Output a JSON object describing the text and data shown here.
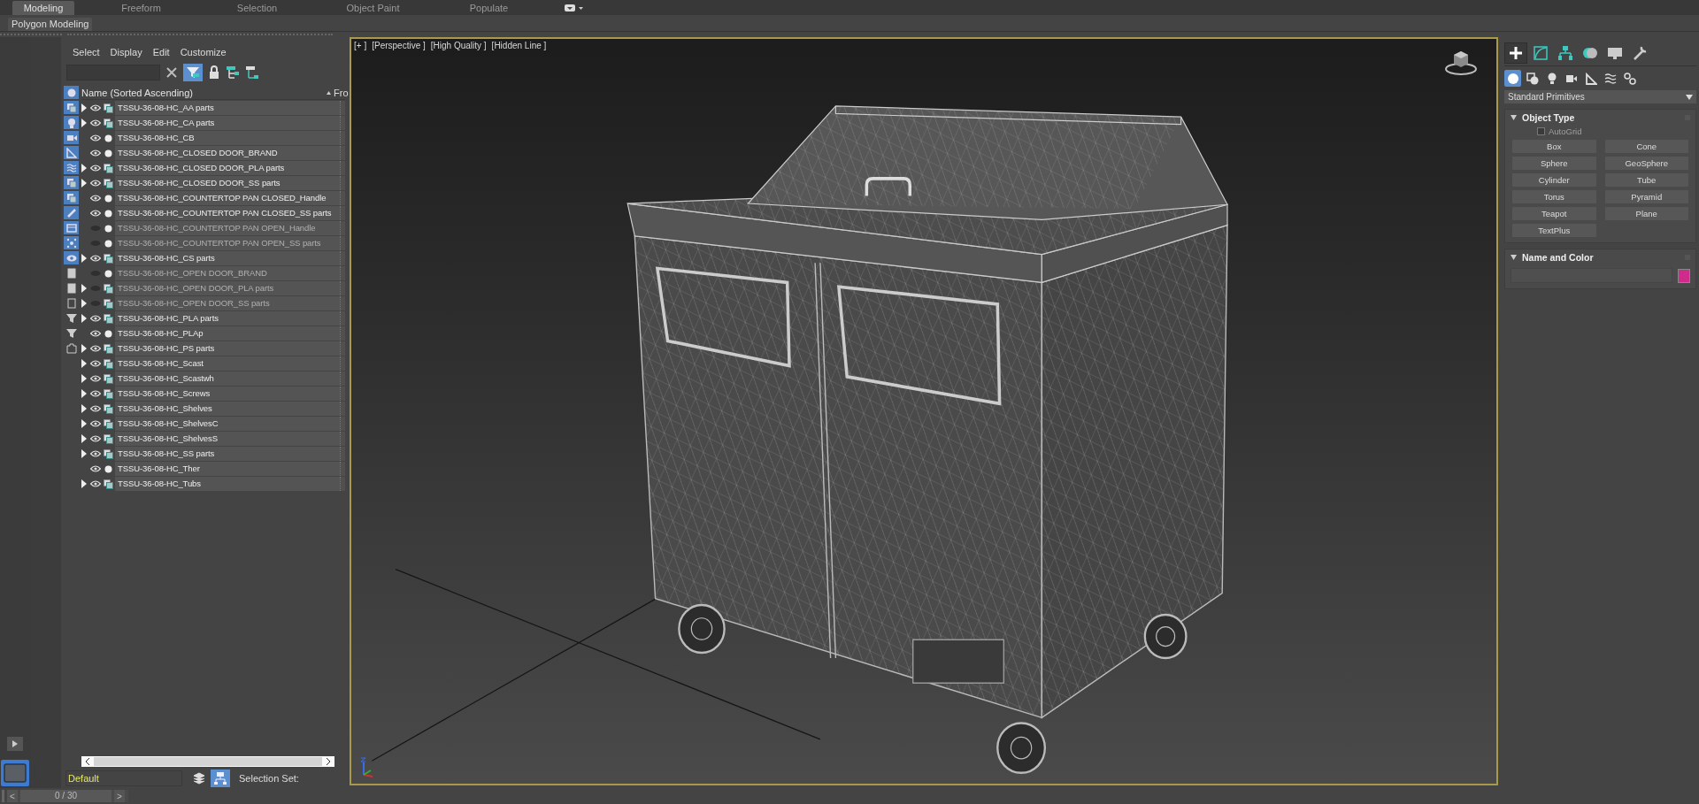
{
  "ribbon_tabs": [
    {
      "label": "Modeling",
      "selected": true
    },
    {
      "label": "Freeform",
      "selected": false
    },
    {
      "label": "Selection",
      "selected": false
    },
    {
      "label": "Object Paint",
      "selected": false
    },
    {
      "label": "Populate",
      "selected": false
    }
  ],
  "ribbon_panel": {
    "label": "Polygon Modeling"
  },
  "scene_explorer": {
    "menu": [
      "Select",
      "Display",
      "Edit",
      "Customize"
    ],
    "filters": [
      {
        "kind": "geometry",
        "on": true
      },
      {
        "kind": "shape",
        "on": true
      },
      {
        "kind": "light",
        "on": true
      },
      {
        "kind": "camera",
        "on": true
      },
      {
        "kind": "helper",
        "on": true
      },
      {
        "kind": "spacewarp",
        "on": true
      },
      {
        "kind": "group",
        "on": true
      },
      {
        "kind": "xref",
        "on": true
      },
      {
        "kind": "bone",
        "on": true
      },
      {
        "kind": "container",
        "on": true
      },
      {
        "kind": "particle",
        "on": true
      },
      {
        "kind": "hidden",
        "on": true
      },
      {
        "kind": "document",
        "on": false
      },
      {
        "kind": "square",
        "on": false
      },
      {
        "kind": "frame",
        "on": false
      },
      {
        "kind": "filter-gear",
        "on": false
      },
      {
        "kind": "filter",
        "on": false
      },
      {
        "kind": "bracket",
        "on": false
      }
    ],
    "columns": [
      "Name (Sorted Ascending)",
      "Fro"
    ],
    "rows": [
      {
        "name": "TSSU-36-08-HC_AA parts",
        "kind": "group",
        "expander": true,
        "hidden": false
      },
      {
        "name": "TSSU-36-08-HC_CA parts",
        "kind": "group",
        "expander": true,
        "hidden": false
      },
      {
        "name": "TSSU-36-08-HC_CB",
        "kind": "object",
        "expander": false,
        "hidden": false
      },
      {
        "name": "TSSU-36-08-HC_CLOSED DOOR_BRAND",
        "kind": "object",
        "expander": false,
        "hidden": false
      },
      {
        "name": "TSSU-36-08-HC_CLOSED DOOR_PLA parts",
        "kind": "group",
        "expander": true,
        "hidden": false
      },
      {
        "name": "TSSU-36-08-HC_CLOSED DOOR_SS parts",
        "kind": "group",
        "expander": true,
        "hidden": false
      },
      {
        "name": "TSSU-36-08-HC_COUNTERTOP PAN CLOSED_Handle",
        "kind": "object",
        "expander": false,
        "hidden": false
      },
      {
        "name": "TSSU-36-08-HC_COUNTERTOP PAN CLOSED_SS parts",
        "kind": "object",
        "expander": false,
        "hidden": false
      },
      {
        "name": "TSSU-36-08-HC_COUNTERTOP PAN OPEN_Handle",
        "kind": "object",
        "expander": false,
        "hidden": true
      },
      {
        "name": "TSSU-36-08-HC_COUNTERTOP PAN OPEN_SS parts",
        "kind": "object",
        "expander": false,
        "hidden": true
      },
      {
        "name": "TSSU-36-08-HC_CS parts",
        "kind": "group",
        "expander": true,
        "hidden": false
      },
      {
        "name": "TSSU-36-08-HC_OPEN DOOR_BRAND",
        "kind": "object",
        "expander": false,
        "hidden": true
      },
      {
        "name": "TSSU-36-08-HC_OPEN DOOR_PLA parts",
        "kind": "group",
        "expander": true,
        "hidden": true
      },
      {
        "name": "TSSU-36-08-HC_OPEN DOOR_SS parts",
        "kind": "group",
        "expander": true,
        "hidden": true
      },
      {
        "name": "TSSU-36-08-HC_PLA parts",
        "kind": "group",
        "expander": true,
        "hidden": false
      },
      {
        "name": "TSSU-36-08-HC_PLAp",
        "kind": "object",
        "expander": false,
        "hidden": false
      },
      {
        "name": "TSSU-36-08-HC_PS parts",
        "kind": "group",
        "expander": true,
        "hidden": false
      },
      {
        "name": "TSSU-36-08-HC_Scast",
        "kind": "group",
        "expander": true,
        "hidden": false
      },
      {
        "name": "TSSU-36-08-HC_Scastwh",
        "kind": "group",
        "expander": true,
        "hidden": false
      },
      {
        "name": "TSSU-36-08-HC_Screws",
        "kind": "group",
        "expander": true,
        "hidden": false
      },
      {
        "name": "TSSU-36-08-HC_Shelves",
        "kind": "group",
        "expander": true,
        "hidden": false
      },
      {
        "name": "TSSU-36-08-HC_ShelvesC",
        "kind": "group",
        "expander": true,
        "hidden": false
      },
      {
        "name": "TSSU-36-08-HC_ShelvesS",
        "kind": "group",
        "expander": true,
        "hidden": false
      },
      {
        "name": "TSSU-36-08-HC_SS parts",
        "kind": "group",
        "expander": true,
        "hidden": false
      },
      {
        "name": "TSSU-36-08-HC_Ther",
        "kind": "object",
        "expander": false,
        "hidden": false
      },
      {
        "name": "TSSU-36-08-HC_Tubs",
        "kind": "group",
        "expander": true,
        "hidden": false
      }
    ],
    "layer": "Default",
    "selection_set_label": "Selection Set:"
  },
  "viewport": {
    "labels": [
      "[+ ]",
      "[Perspective ]",
      "[High Quality ]",
      "[Hidden Line ]"
    ]
  },
  "command_panel": {
    "tabs": [
      {
        "kind": "create",
        "selected": true
      },
      {
        "kind": "modify",
        "selected": false
      },
      {
        "kind": "hierarchy",
        "selected": false
      },
      {
        "kind": "motion",
        "selected": false
      },
      {
        "kind": "display",
        "selected": false
      },
      {
        "kind": "utilities",
        "selected": false
      }
    ],
    "categories": [
      {
        "kind": "geometry",
        "selected": true
      },
      {
        "kind": "shapes",
        "selected": false
      },
      {
        "kind": "lights",
        "selected": false
      },
      {
        "kind": "cameras",
        "selected": false
      },
      {
        "kind": "helpers",
        "selected": false
      },
      {
        "kind": "spacewarps",
        "selected": false
      },
      {
        "kind": "systems",
        "selected": false
      }
    ],
    "dropdown": "Standard Primitives",
    "object_type": {
      "title": "Object Type",
      "autogrid": {
        "label": "AutoGrid",
        "checked": false,
        "disabled": true
      },
      "buttons": [
        "Box",
        "Cone",
        "Sphere",
        "GeoSphere",
        "Cylinder",
        "Tube",
        "Torus",
        "Pyramid",
        "Teapot",
        "Plane",
        "TextPlus"
      ]
    },
    "name_and_color": {
      "title": "Name and Color",
      "color": "#d02a8c"
    }
  },
  "timeline": {
    "prev": "<",
    "position": "0 / 30",
    "next": ">",
    "level": 0
  }
}
